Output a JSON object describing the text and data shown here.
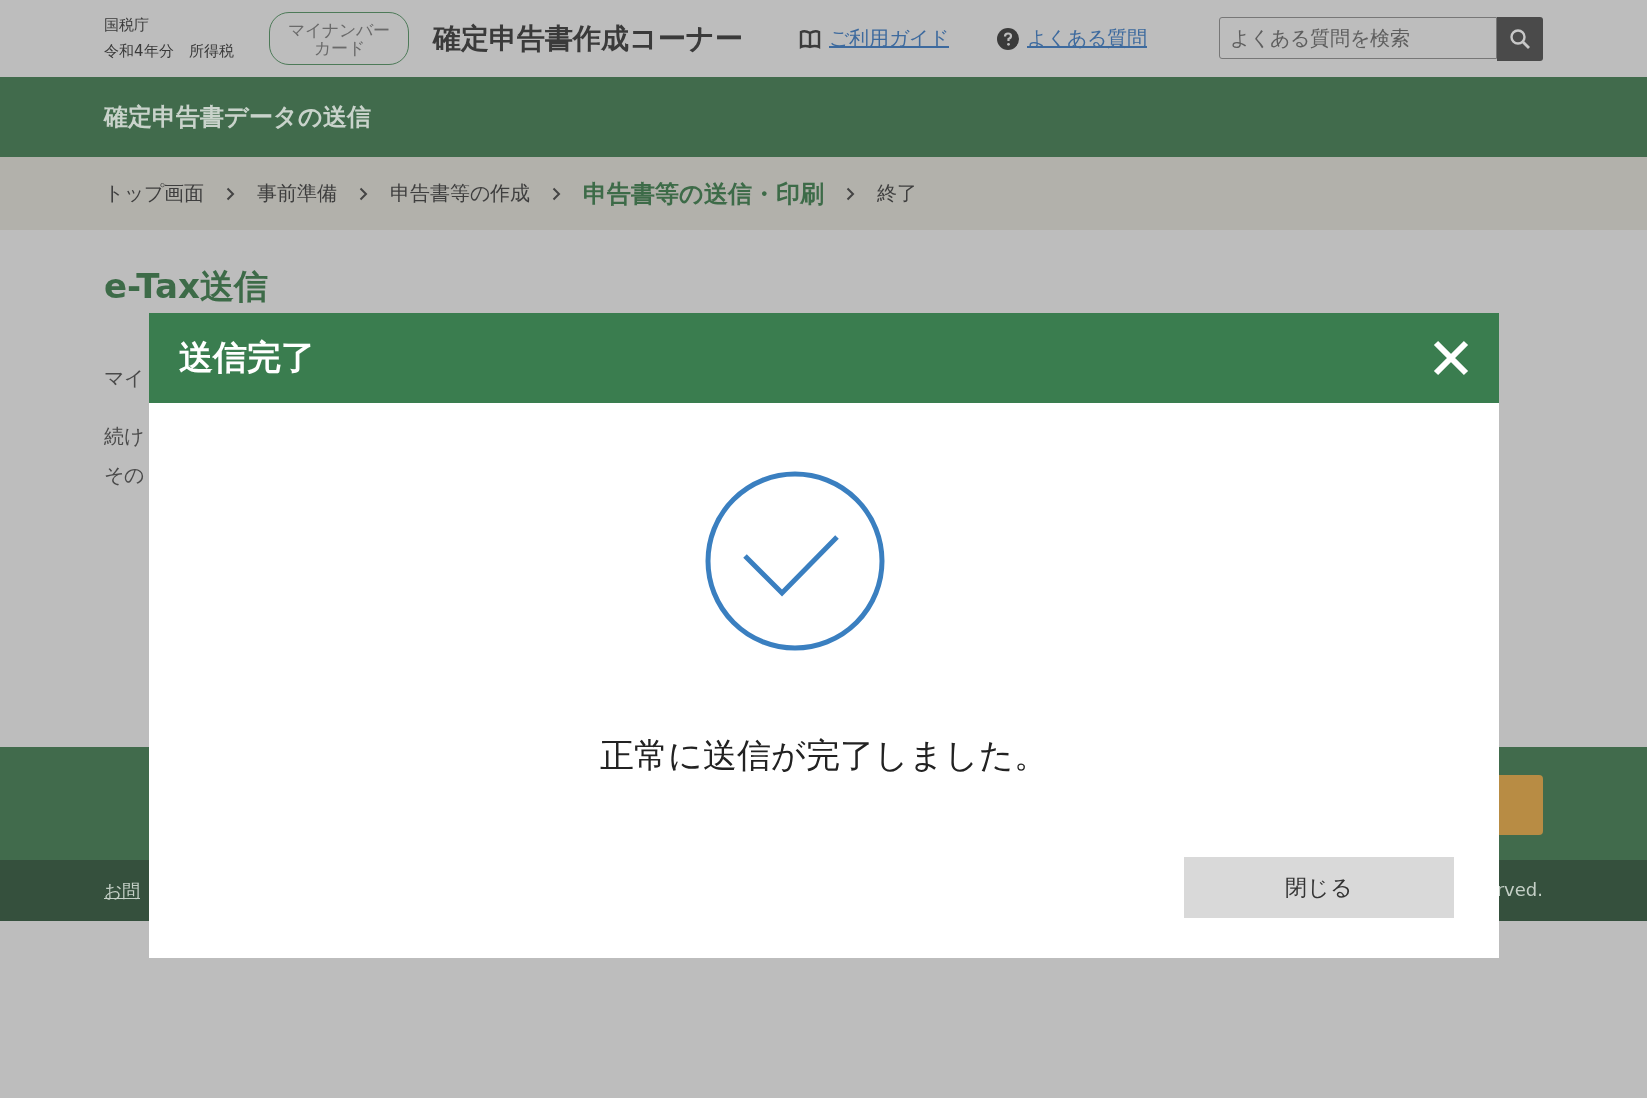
{
  "header": {
    "agency": "国税庁",
    "tax_year": "令和4年分　所得税",
    "mynumber_button": [
      "マイナンバー",
      "カード"
    ],
    "title": "確定申告書作成コーナー",
    "links": [
      {
        "kind": "guide",
        "label": "ご利用ガイド"
      },
      {
        "kind": "faq",
        "label": "よくある質問"
      }
    ],
    "search": {
      "placeholder": "よくある質問を検索"
    }
  },
  "page_title_bar": "確定申告書データの送信",
  "breadcrumb": [
    {
      "label": "トップ画面",
      "selected": false
    },
    {
      "label": "事前準備",
      "selected": false
    },
    {
      "label": "申告書等の作成",
      "selected": false
    },
    {
      "label": "申告書等の送信・印刷",
      "selected": true
    },
    {
      "label": "終了",
      "selected": false
    }
  ],
  "content": {
    "heading": "e-Tax送信",
    "paragraphs": [
      "マイ",
      "続け",
      "その"
    ]
  },
  "footer": {
    "link": "お問",
    "copyright": "rved."
  },
  "modal": {
    "title": "送信完了",
    "message": "正常に送信が完了しました。",
    "close_button": "閉じる"
  }
}
